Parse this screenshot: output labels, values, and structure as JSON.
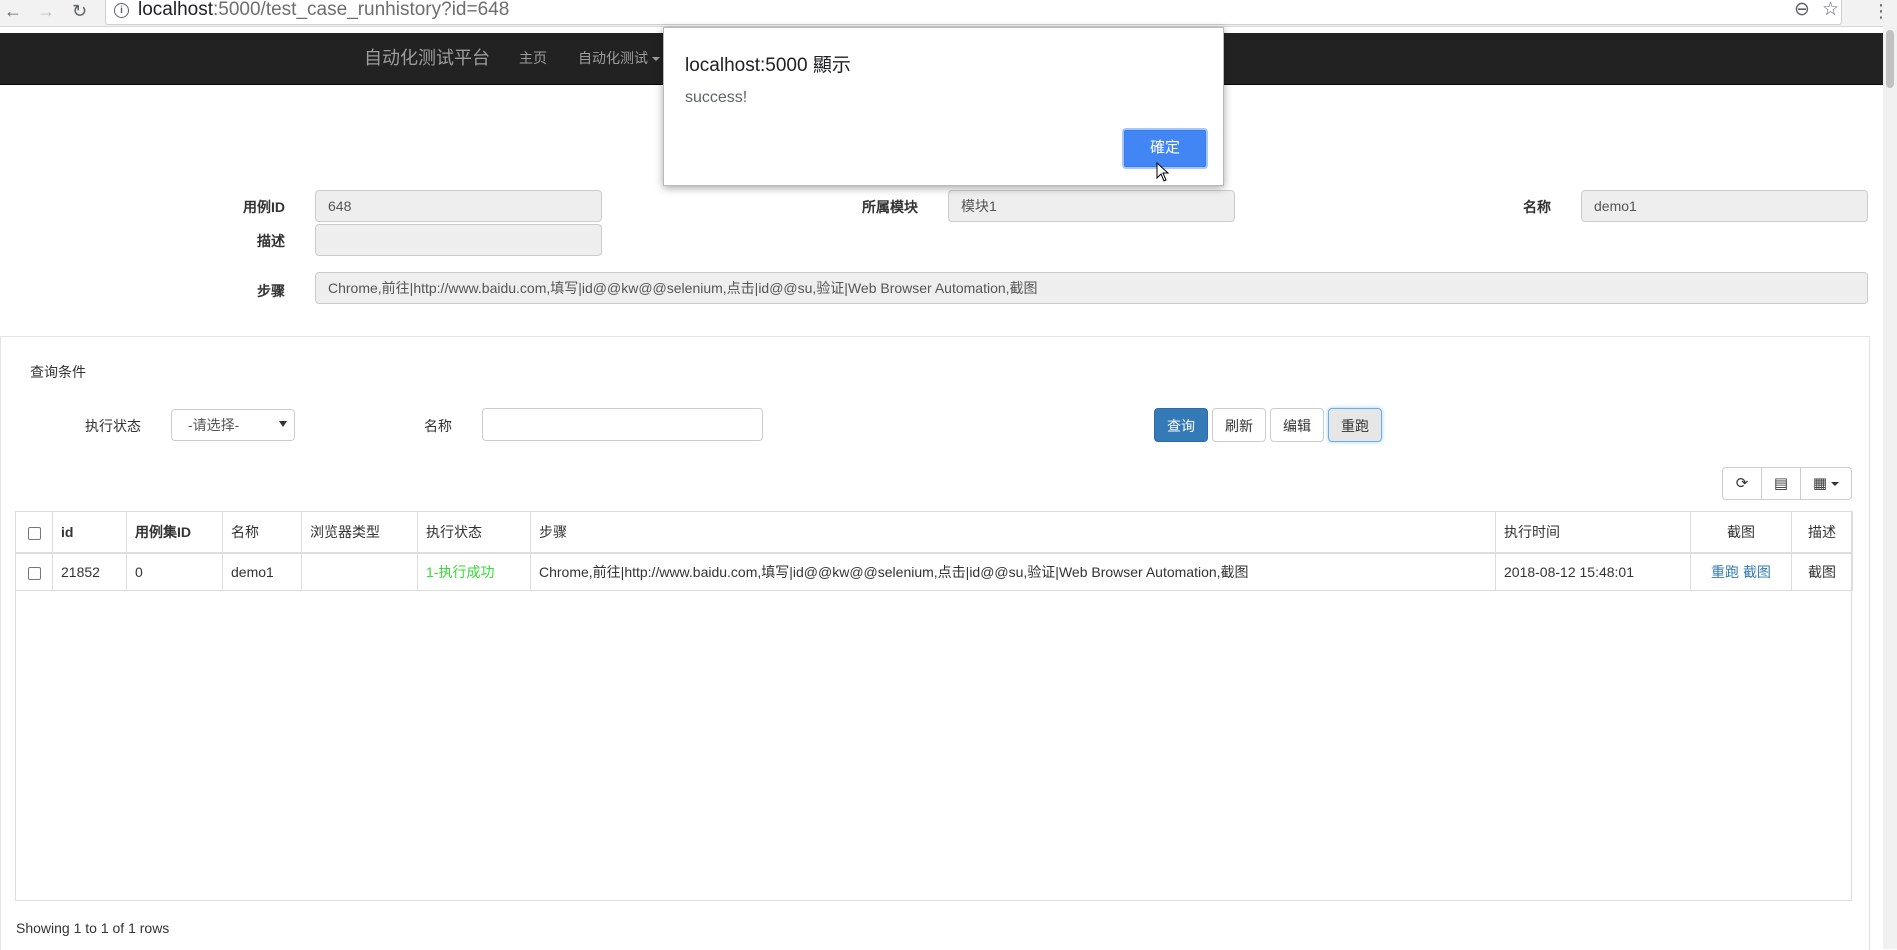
{
  "browser": {
    "url_host": "localhost",
    "url_rest": ":5000/test_case_runhistory?id=648",
    "back_icon": "←",
    "forward_icon": "→",
    "reload_icon": "↻",
    "zoom_icon": "⊖",
    "star_icon": "☆",
    "menu_icon": "⋮"
  },
  "navbar": {
    "brand": "自动化测试平台",
    "items": [
      {
        "label": "主页"
      },
      {
        "label": "自动化测试"
      }
    ]
  },
  "dialog": {
    "title": "localhost:5000 顯示",
    "message": "success!",
    "ok_label": "確定"
  },
  "detail": {
    "case_id_label": "用例ID",
    "case_id_value": "648",
    "module_label": "所属模块",
    "module_value": "模块1",
    "name_label": "名称",
    "name_value": "demo1",
    "desc_label": "描述",
    "desc_value": "",
    "steps_label": "步骤",
    "steps_value": "Chrome,前往|http://www.baidu.com,填写|id@@kw@@selenium,点击|id@@su,验证|Web Browser Automation,截图"
  },
  "query": {
    "title": "查询条件",
    "status_label": "执行状态",
    "status_selected": "-请选择-",
    "name_label": "名称",
    "name_value": "",
    "buttons": {
      "search": "查询",
      "refresh": "刷新",
      "edit": "编辑",
      "rerun": "重跑"
    }
  },
  "toolbar": {
    "refresh_icon": "⟳",
    "toggle_icon": "▤",
    "columns_icon": "▦"
  },
  "table": {
    "headers": [
      "id",
      "用例集ID",
      "名称",
      "浏览器类型",
      "执行状态",
      "步骤",
      "执行时间",
      "截图",
      "描述"
    ],
    "rows": [
      {
        "id": "21852",
        "suite_id": "0",
        "name": "demo1",
        "browser": "",
        "status": "1-执行成功",
        "steps": "Chrome,前往|http://www.baidu.com,填写|id@@kw@@selenium,点击|id@@su,验证|Web Browser Automation,截图",
        "time": "2018-08-12 15:48:01",
        "action_rerun": "重跑",
        "action_screenshot": "截图",
        "desc": "截图"
      }
    ],
    "status_color": "#33dd33"
  },
  "pagination": {
    "showing": "Showing 1 to 1 of 1 rows"
  }
}
